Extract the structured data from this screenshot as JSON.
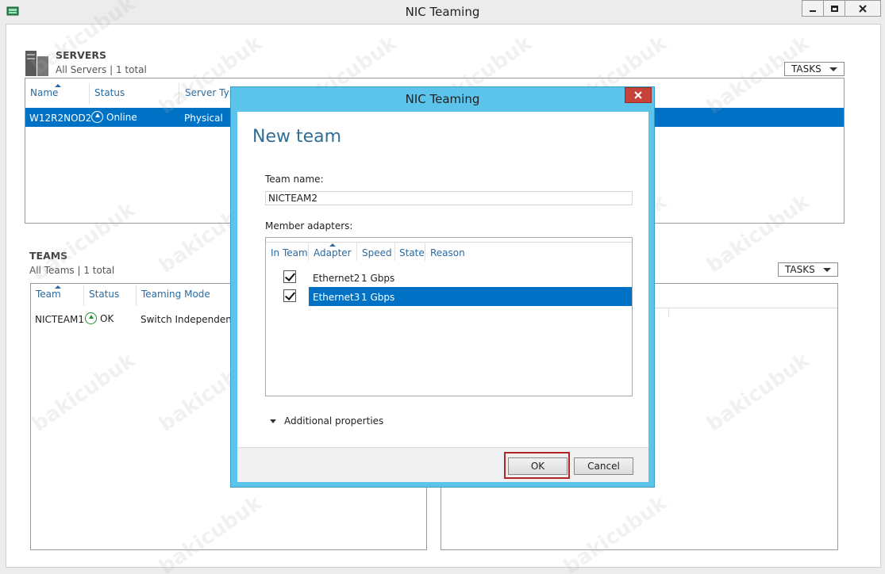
{
  "window": {
    "title": "NIC Teaming"
  },
  "servers": {
    "title": "SERVERS",
    "subtitle": "All Servers | 1 total",
    "tasks_label": "TASKS",
    "columns": [
      "Name",
      "Status",
      "Server Typ"
    ],
    "rows": [
      {
        "name": "W12R2NOD2",
        "status": "Online",
        "type": "Physical"
      }
    ]
  },
  "teams": {
    "title": "TEAMS",
    "subtitle": "All Teams | 1 total",
    "tasks_label": "TASKS",
    "columns": [
      "Team",
      "Status",
      "Teaming Mode"
    ],
    "rows": [
      {
        "team": "NICTEAM1",
        "status": "OK",
        "mode": "Switch Independent"
      }
    ]
  },
  "dialog": {
    "title": "NIC Teaming",
    "heading": "New team",
    "team_name_label": "Team name:",
    "team_name_value": "NICTEAM2",
    "member_adapters_label": "Member adapters:",
    "adapter_columns": [
      "In Team",
      "Adapter",
      "Speed",
      "State",
      "Reason"
    ],
    "adapters": [
      {
        "adapter": "Ethernet2",
        "speed": "1 Gbps",
        "in_team": true,
        "selected": false
      },
      {
        "adapter": "Ethernet3",
        "speed": "1 Gbps",
        "in_team": true,
        "selected": true
      }
    ],
    "additional_properties_label": "Additional properties",
    "ok_label": "OK",
    "cancel_label": "Cancel"
  },
  "watermark": "bakicubuk",
  "colors": {
    "selection": "#0072c6",
    "dialog_frame": "#5cc3ea",
    "heading": "#2f6e95",
    "header_link": "#2a6aa0",
    "ok_highlight": "#b2262a"
  }
}
